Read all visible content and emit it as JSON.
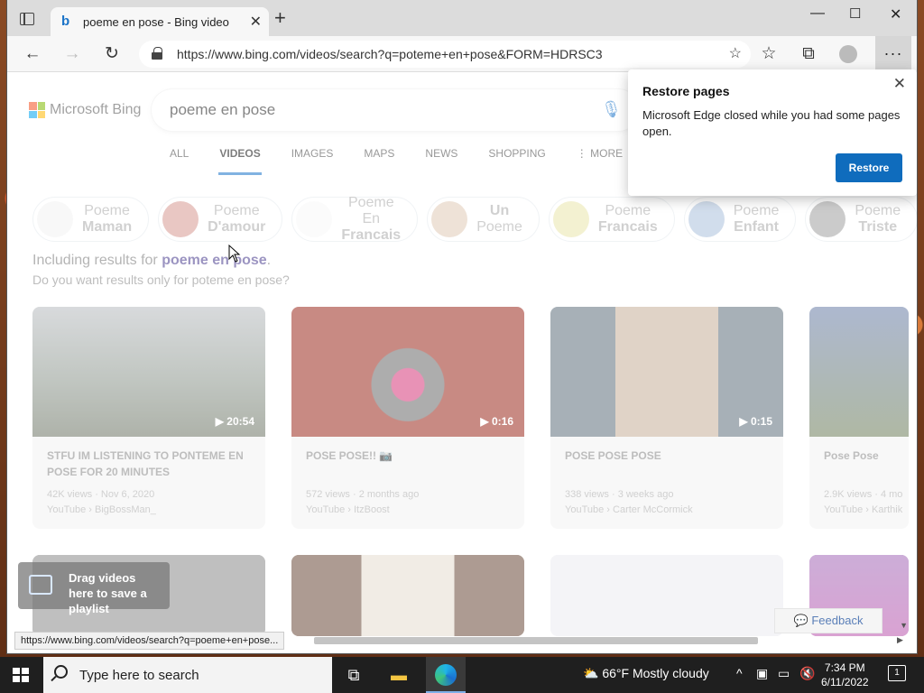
{
  "browser": {
    "tab_title": "poeme en pose - Bing video",
    "tab_favicon": "b",
    "url": "https://www.bing.com/videos/search?q=poteme+en+pose&FORM=HDRSC3",
    "status_url": "https://www.bing.com/videos/search?q=poeme+en+pose..."
  },
  "bing": {
    "logo_text": "Microsoft Bing",
    "query": "poeme en pose",
    "nav": [
      "ALL",
      "VIDEOS",
      "IMAGES",
      "MAPS",
      "NEWS",
      "SHOPPING",
      "MORE"
    ],
    "nav_active": "VIDEOS",
    "chips": [
      {
        "line1": "Poeme",
        "line2": "Maman",
        "color": "#e8e8e8"
      },
      {
        "line1": "Poeme",
        "line2": "D'amour",
        "color": "#b9463c"
      },
      {
        "line1": "Poeme En",
        "line2": "Francais",
        "color": "#f2f2f2"
      },
      {
        "line1": "Un",
        "line2": "Poeme",
        "color": "#c9a27c"
      },
      {
        "line1": "Poeme",
        "line2": "Francais",
        "color": "#d9d26a"
      },
      {
        "line1": "Poeme",
        "line2": "Enfant",
        "color": "#6a8fc0"
      },
      {
        "line1": "Poeme",
        "line2": "Triste",
        "color": "#555555"
      }
    ],
    "including_prefix": "Including results for ",
    "including_term": "poeme en pose",
    "including_suffix": ".",
    "only_prompt": "Do you want results only for poteme en pose?",
    "videos": [
      {
        "title": "STFU IM LISTENING TO PONTEME EN POSE FOR 20 MINUTES",
        "views": "42K views · Nov 6, 2020",
        "source": "YouTube › BigBossMan_",
        "duration": "20:54",
        "thumb": "#9aa39a"
      },
      {
        "title": "POSE POSE!! 📷",
        "views": "572 views · 2 months ago",
        "source": "YouTube › ItzBoost",
        "duration": "0:16",
        "thumb": "#9b2a1e"
      },
      {
        "title": "POSE POSE POSE",
        "views": "338 views · 3 weeks ago",
        "source": "YouTube › Carter McCormick",
        "duration": "0:15",
        "thumb": "#7f8a96"
      },
      {
        "title": "Pose Pose",
        "views": "2.9K views · 4 mo",
        "source": "YouTube › Karthik",
        "duration": "",
        "thumb": "#6d7f5a"
      }
    ],
    "row2_thumbs": [
      "#8a8a8a",
      "#7a6a5a",
      "#e6e6ea",
      "#8a4a9a"
    ],
    "drag_text": "Drag videos here to save a playlist",
    "feedback": "Feedback"
  },
  "popup": {
    "title": "Restore pages",
    "body": "Microsoft Edge closed while you had some pages open.",
    "button": "Restore"
  },
  "taskbar": {
    "search_placeholder": "Type here to search",
    "weather": "66°F  Mostly cloudy",
    "time": "7:34 PM",
    "date": "6/11/2022",
    "notif_count": "1"
  }
}
